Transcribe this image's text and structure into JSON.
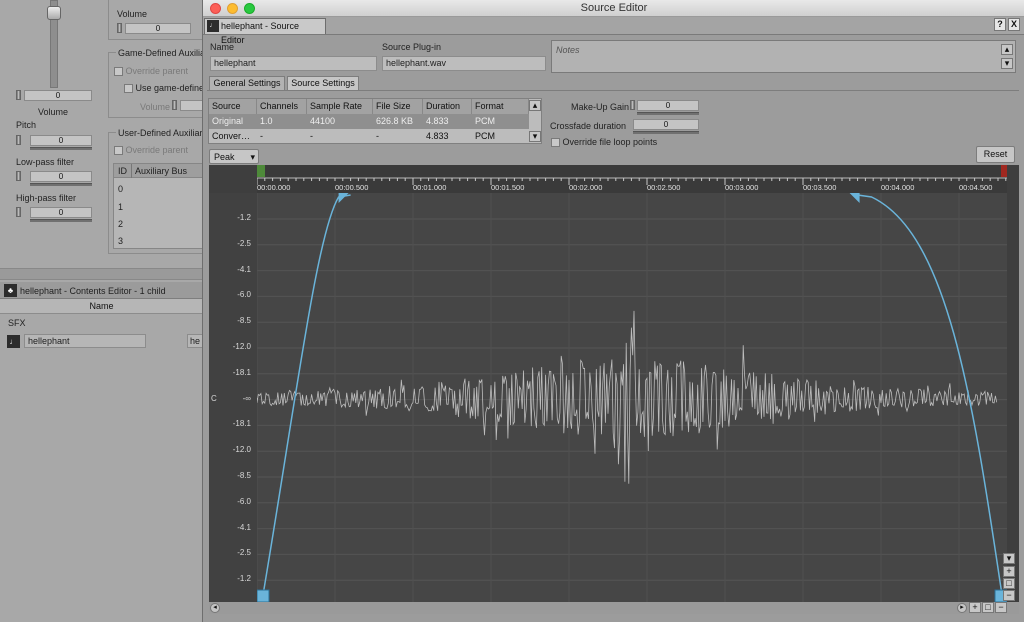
{
  "left_panel": {
    "volume_top_label": "Volume",
    "volume_top_value": "0",
    "volume_label": "Volume",
    "volume_value": "0",
    "pitch_label": "Pitch",
    "pitch_value": "0",
    "lowpass_label": "Low-pass filter",
    "lowpass_value": "0",
    "highpass_label": "High-pass filter",
    "highpass_value": "0",
    "game_aux_title": "Game-Defined Auxilia",
    "game_override": "Override parent",
    "use_game_defined": "Use game-define",
    "game_volume": "Volume",
    "user_aux_title": "User-Defined Auxiliar",
    "user_override": "Override parent",
    "aux_headers": [
      "ID",
      "Auxiliary Bus"
    ],
    "aux_ids": [
      "0",
      "1",
      "2",
      "3"
    ]
  },
  "contents_editor": {
    "title": "hellephant - Contents Editor - 1 child",
    "column_name": "Name",
    "group": "SFX",
    "item": "hellephant",
    "item_side": "he"
  },
  "window": {
    "title": "Source Editor",
    "tab_label": "hellephant - Source Editor",
    "help_btn": "?",
    "close_btn": "X",
    "name_label": "Name",
    "name_value": "hellephant",
    "plugin_label": "Source Plug-in",
    "plugin_value": "hellephant.wav",
    "notes_placeholder": "Notes",
    "tabs": [
      "General Settings",
      "Source Settings"
    ],
    "table_headers": [
      "Source",
      "Channels",
      "Sample Rate",
      "File Size",
      "Duration",
      "Format"
    ],
    "table_rows": [
      [
        "Original",
        "1.0",
        "44100",
        "626.8 KB",
        "4.833",
        "PCM"
      ],
      [
        "Conver…",
        "-",
        "-",
        "-",
        "4.833",
        "PCM"
      ]
    ],
    "makeup_gain_label": "Make-Up Gain",
    "makeup_gain_value": "0",
    "crossfade_label": "Crossfade duration",
    "crossfade_value": "0",
    "override_loop_label": "Override file loop points",
    "view_mode": "Peak",
    "reset_label": "Reset"
  },
  "waveform": {
    "time_labels": [
      "00:00.000",
      "00:00.500",
      "00:01.000",
      "00:01.500",
      "00:02.000",
      "00:02.500",
      "00:03.000",
      "00:03.500",
      "00:04.000",
      "00:04.500"
    ],
    "db_labels": [
      "-1.2",
      "-2.5",
      "-4.1",
      "-6.0",
      "-8.5",
      "-12.0",
      "-18.1",
      "-∞",
      "-18.1",
      "-12.0",
      "-8.5",
      "-6.0",
      "-4.1",
      "-2.5",
      "-1.2"
    ],
    "channel_label": "C",
    "duration_s": 4.833,
    "fade_in_end_s": 0.6,
    "fade_out_start_s": 3.85,
    "colors": {
      "fade": "#6ab4da",
      "wave": "#bdbdbd",
      "bg": "#464646"
    }
  }
}
